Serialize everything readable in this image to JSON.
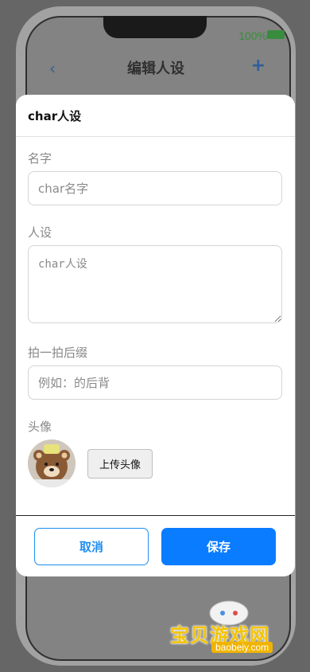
{
  "status_bar": {
    "battery_percent": "100%"
  },
  "nav": {
    "back_icon": "‹",
    "title": "编辑人设",
    "add_icon": "+"
  },
  "modal": {
    "title": "char人设",
    "fields": {
      "name": {
        "label": "名字",
        "placeholder": "char名字",
        "value": ""
      },
      "persona": {
        "label": "人设",
        "placeholder": "char人设",
        "value": ""
      },
      "pat_suffix": {
        "label": "拍一拍后缀",
        "placeholder": "例如：的后背",
        "value": ""
      },
      "avatar": {
        "label": "头像",
        "upload_label": "上传头像"
      }
    },
    "buttons": {
      "cancel": "取消",
      "save": "保存"
    }
  },
  "watermark": {
    "text": "宝贝游戏网",
    "sub": "baobeiy.com"
  },
  "colors": {
    "primary": "#0a7cff",
    "cancel_border": "#1e8ef0",
    "battery": "#27a82e"
  }
}
